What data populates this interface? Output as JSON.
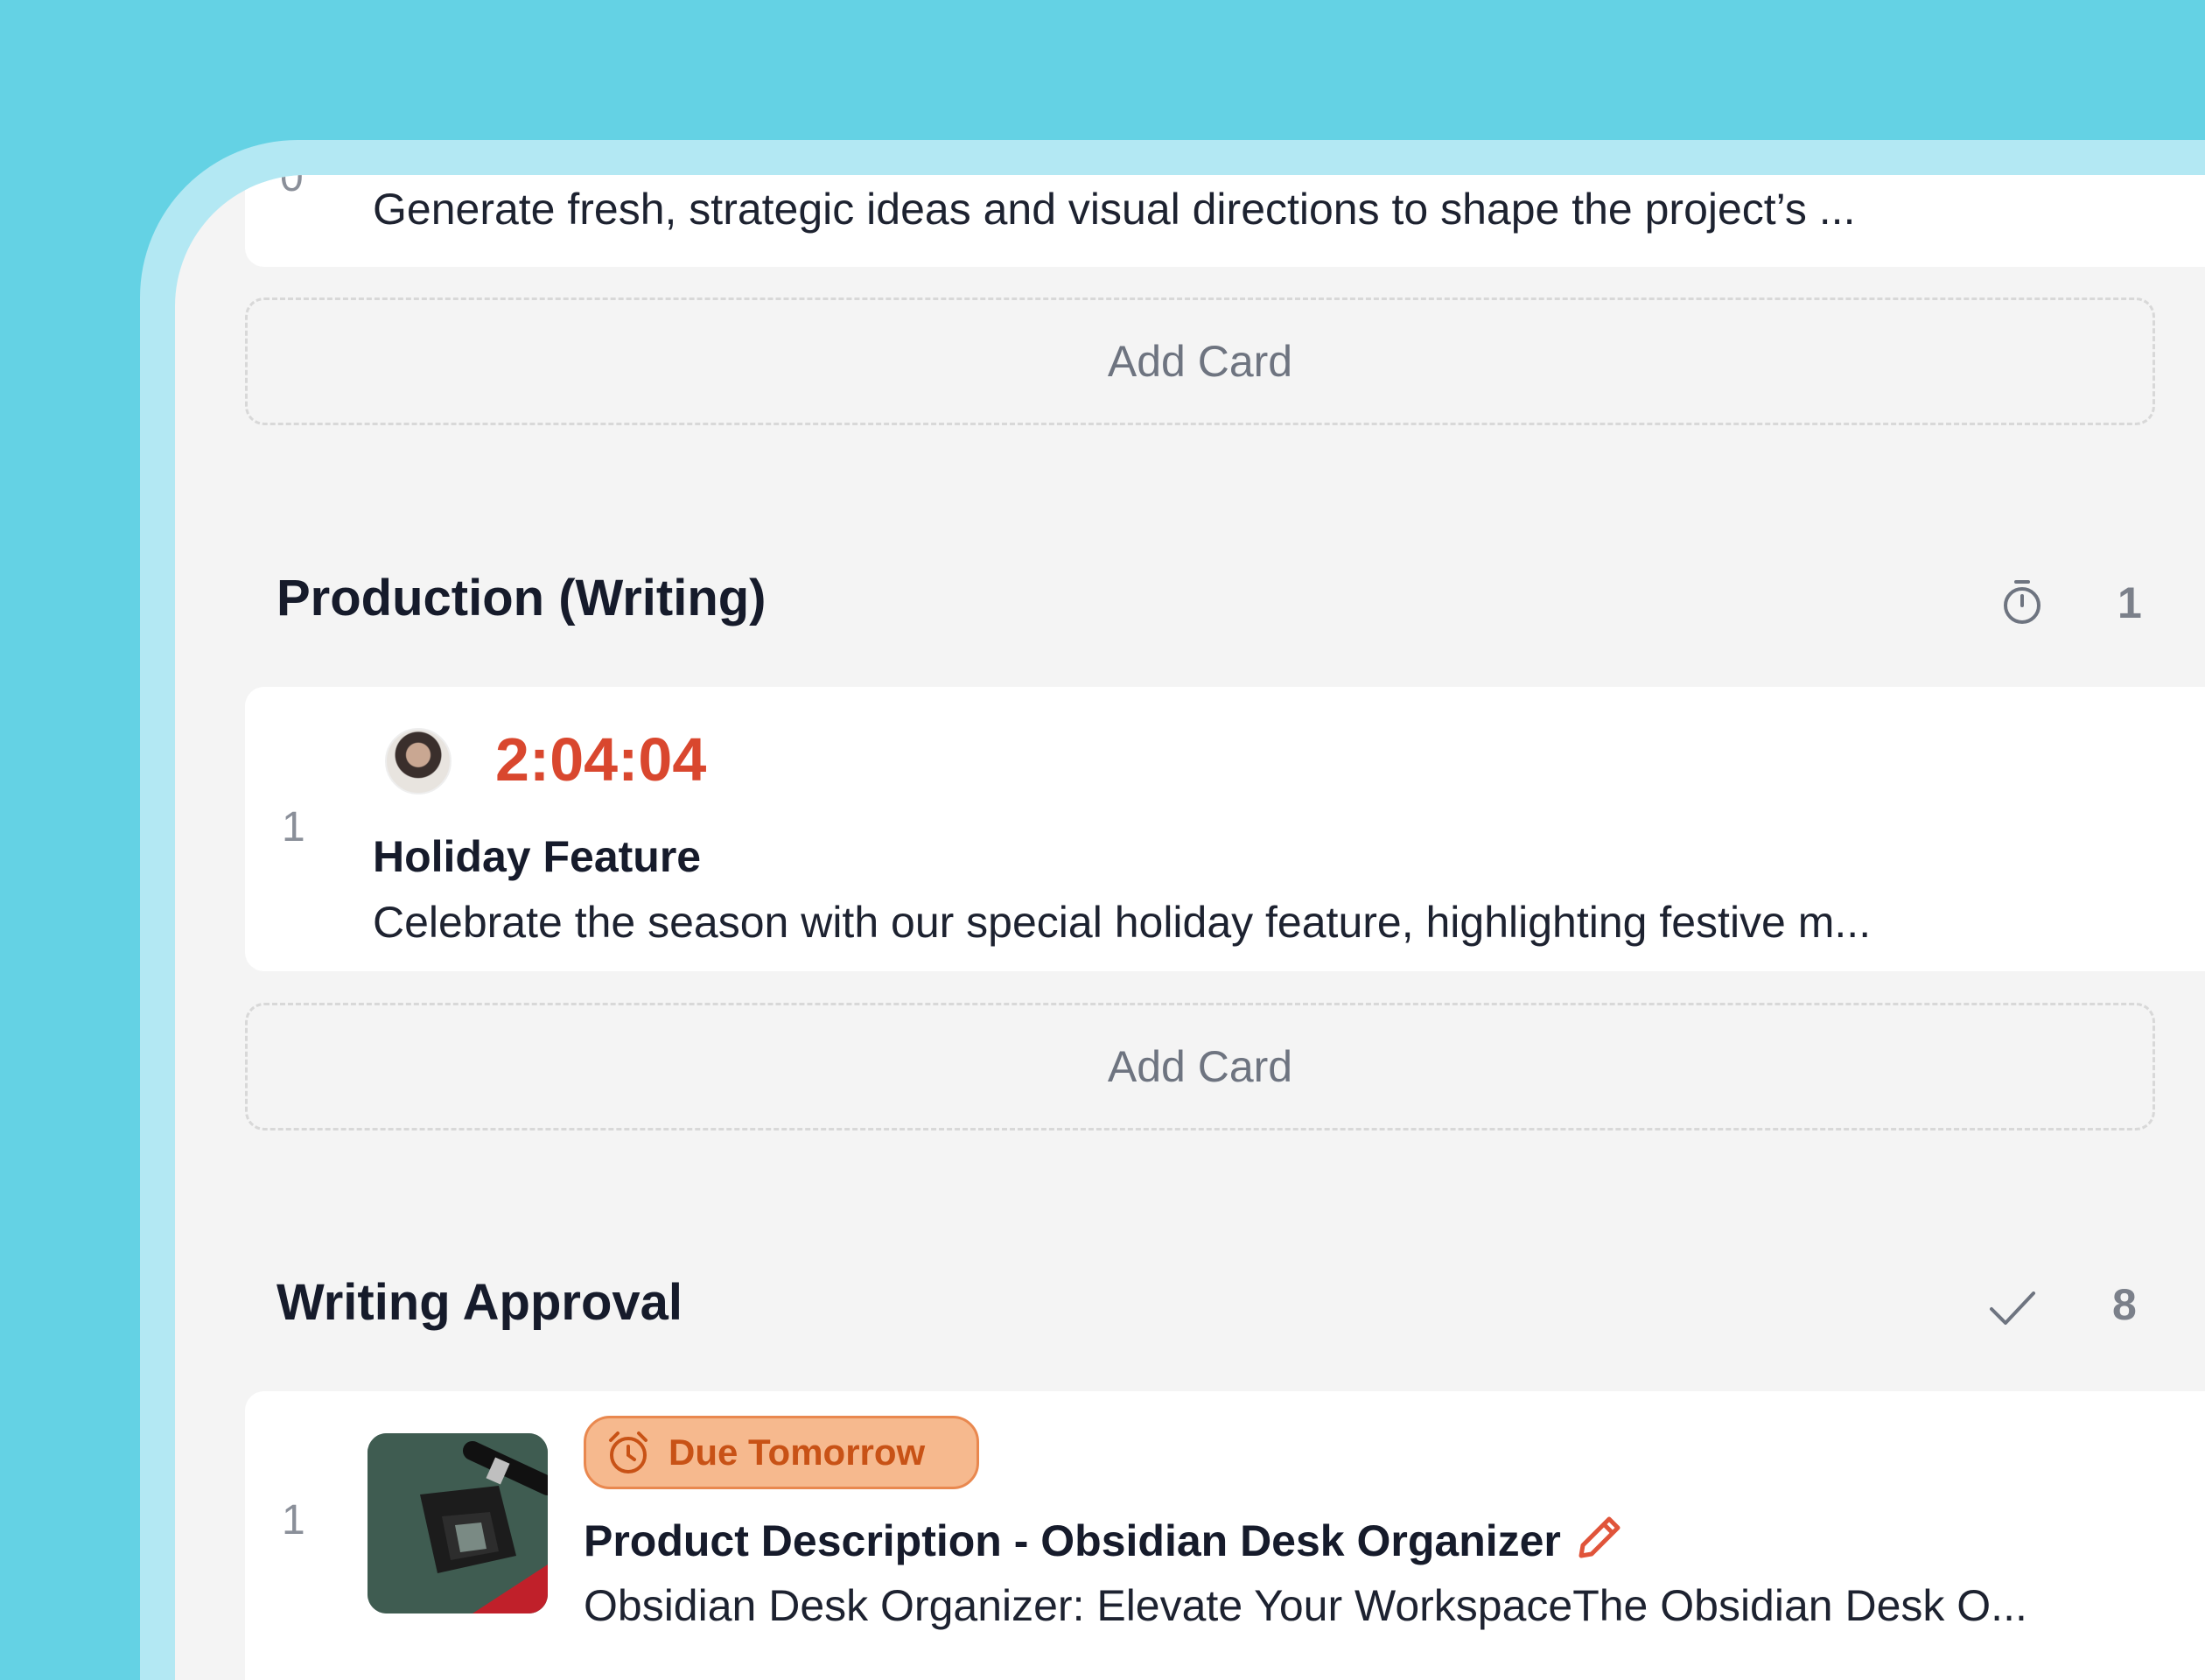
{
  "top_card": {
    "description": "Generate fresh, strategic ideas and visual directions to shape the project’s ..."
  },
  "add_card_label": "Add Card",
  "sections": [
    {
      "title": "Production (Writing)",
      "icon": "stopwatch-icon",
      "count": "1",
      "cards": [
        {
          "index": "1",
          "timer": "2:04:04",
          "title": "Holiday Feature",
          "description": "Celebrate the season with our special holiday feature, highlighting festive m..."
        }
      ]
    },
    {
      "title": "Writing Approval",
      "icon": "check-icon",
      "count": "8",
      "cards": [
        {
          "index": "1",
          "badge": "Due Tomorrow",
          "title": "Product Description - Obsidian Desk Organizer",
          "description": "Obsidian Desk Organizer: Elevate Your WorkspaceThe Obsidian Desk O..."
        }
      ]
    }
  ],
  "colors": {
    "background": "#64d2e4",
    "timer": "#d9472e",
    "badge_bg": "#f6b98e",
    "badge_text": "#c85216"
  }
}
